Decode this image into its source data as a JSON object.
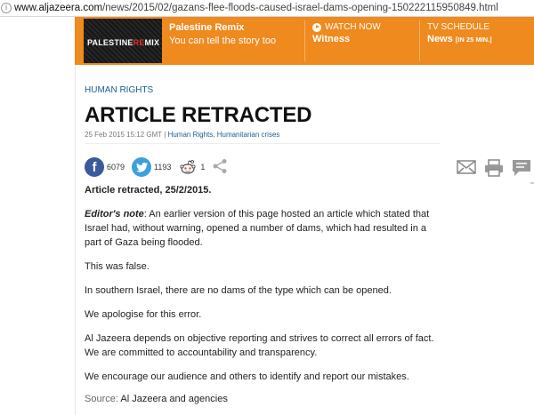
{
  "url_bar": {
    "host": "www.aljazeera.com",
    "path": "/news/2015/02/gazans-flee-floods-caused-israel-dams-opening-150222115950849.html"
  },
  "banner": {
    "promo": {
      "thumb_text_main": "PALESTINE",
      "thumb_text_accent": "RE",
      "thumb_text_end": "MIX",
      "title": "Palestine Remix",
      "subtitle": "You can tell the story too"
    },
    "watch": {
      "label": "WATCH NOW",
      "show": "Witness"
    },
    "schedule": {
      "label": "TV SCHEDULE",
      "show": "News",
      "mins": "[IN 25 MIN.]"
    }
  },
  "article": {
    "kicker": "HUMAN RIGHTS",
    "headline": "ARTICLE RETRACTED",
    "date": "25 Feb 2015 15:12 GMT",
    "sep": "|",
    "topics": "Human Rights, Humanitarian crises",
    "share": {
      "facebook_count": "6079",
      "twitter_count": "1193",
      "reddit_count": "1"
    },
    "lead": "Article retracted, 25/2/2015.",
    "editor_label": "Editor's note",
    "editor_text": ": An earlier version of this page hosted an article which stated that Israel had, without warning, opened a number of dams, which had resulted in a part of Gaza being flooded.",
    "p2": "This was false.",
    "p3": "In southern Israel, there are no dams of the type which can be opened.",
    "p4": "We apologise for this error.",
    "p5": "Al Jazeera depends on objective reporting and strives to correct all errors of fact. We are committed to accountability and transparency.",
    "p6": "We encourage our audience and others to identify and report our mistakes.",
    "source_label": "Source:",
    "source_value": "Al Jazeera and agencies"
  },
  "colors": {
    "brand_orange": "#ee8a1e",
    "link_blue": "#1a5c96",
    "facebook": "#3b5a9a",
    "twitter": "#3ea0da"
  },
  "icons": [
    "page-icon",
    "play-icon",
    "facebook-icon",
    "twitter-icon",
    "reddit-icon",
    "share-icon",
    "email-icon",
    "print-icon",
    "comment-icon"
  ]
}
